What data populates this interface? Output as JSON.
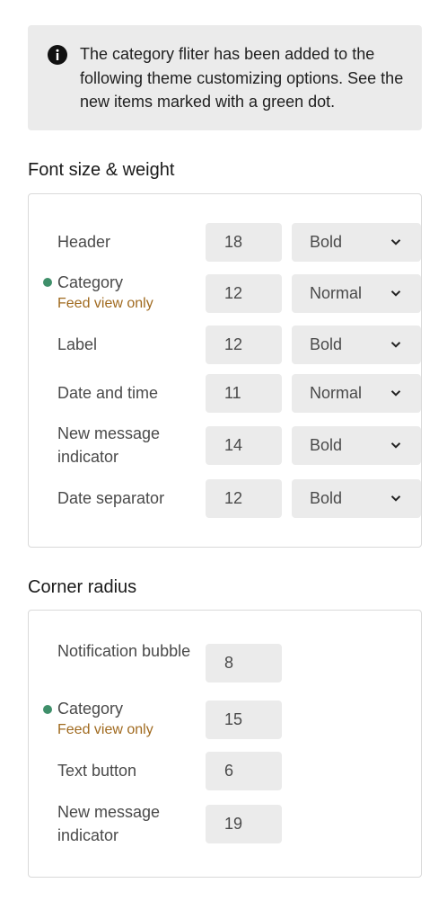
{
  "notice": {
    "icon": "info-icon",
    "text": "The category fliter has been added to the following theme customizing options. See the new items marked with a green dot."
  },
  "font_section": {
    "title": "Font size & weight",
    "rows": [
      {
        "label": "Header",
        "sublabel": "",
        "new": false,
        "size": "18",
        "weight": "Bold"
      },
      {
        "label": "Category",
        "sublabel": "Feed view only",
        "new": true,
        "size": "12",
        "weight": "Normal"
      },
      {
        "label": "Label",
        "sublabel": "",
        "new": false,
        "size": "12",
        "weight": "Bold"
      },
      {
        "label": "Date and time",
        "sublabel": "",
        "new": false,
        "size": "11",
        "weight": "Normal"
      },
      {
        "label": "New message indicator",
        "sublabel": "",
        "new": false,
        "size": "14",
        "weight": "Bold"
      },
      {
        "label": "Date separator",
        "sublabel": "",
        "new": false,
        "size": "12",
        "weight": "Bold"
      }
    ]
  },
  "radius_section": {
    "title": "Corner radius",
    "rows": [
      {
        "label": "Notification bubble",
        "sublabel": "",
        "new": false,
        "value": "8"
      },
      {
        "label": "Category",
        "sublabel": "Feed view only",
        "new": true,
        "value": "15"
      },
      {
        "label": "Text button",
        "sublabel": "",
        "new": false,
        "value": "6"
      },
      {
        "label": "New message indicator",
        "sublabel": "",
        "new": false,
        "value": "19"
      }
    ]
  },
  "colors": {
    "new_dot": "#3f8f6a",
    "sublabel": "#a06a1f",
    "field_bg": "#ebebeb",
    "notice_bg": "#ebebeb"
  }
}
